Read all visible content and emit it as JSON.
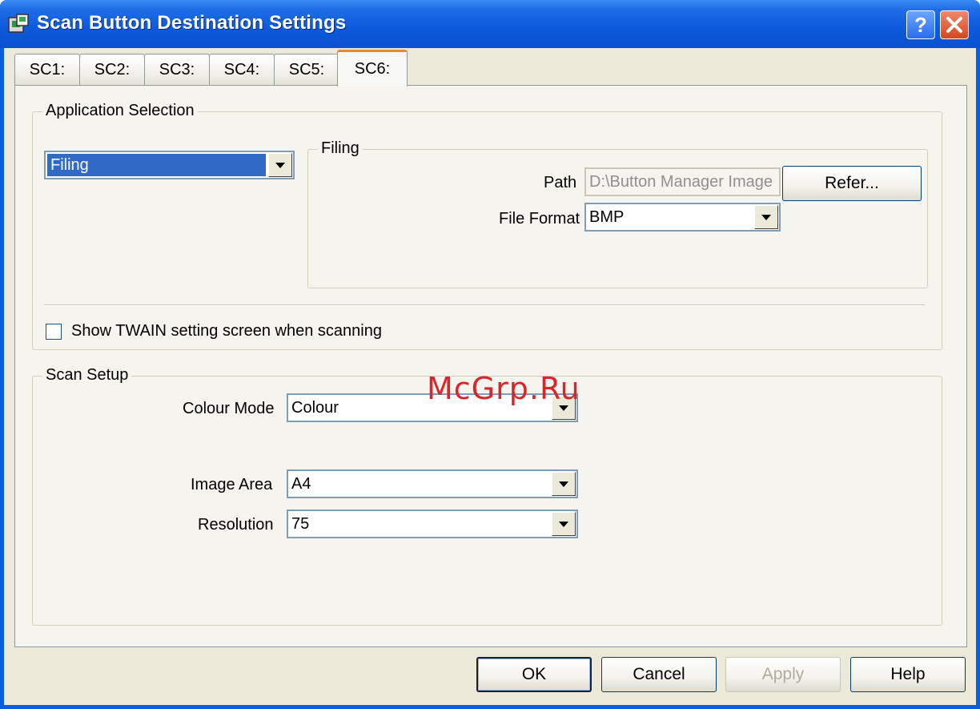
{
  "window": {
    "title": "Scan Button Destination Settings",
    "help_label": "?",
    "icon": "scanner-app-icon"
  },
  "tabs": [
    {
      "label": "SC1:"
    },
    {
      "label": "SC2:"
    },
    {
      "label": "SC3:"
    },
    {
      "label": "SC4:"
    },
    {
      "label": "SC5:"
    },
    {
      "label": "SC6:",
      "active": true
    }
  ],
  "application_selection": {
    "group_label": "Application Selection",
    "application_value": "Filing",
    "filing": {
      "group_label": "Filing",
      "path_label": "Path",
      "path_value": "D:\\Button Manager Image",
      "refer_button": "Refer...",
      "file_format_label": "File Format",
      "file_format_value": "BMP"
    },
    "show_twain_label": "Show TWAIN setting screen when scanning",
    "show_twain_checked": false
  },
  "scan_setup": {
    "group_label": "Scan Setup",
    "colour_mode_label": "Colour Mode",
    "colour_mode_value": "Colour",
    "image_area_label": "Image Area",
    "image_area_value": "A4",
    "resolution_label": "Resolution",
    "resolution_value": "75"
  },
  "watermark": "McGrp.Ru",
  "buttons": {
    "ok": "OK",
    "cancel": "Cancel",
    "apply": "Apply",
    "help": "Help"
  },
  "colors": {
    "titlebar": "#0a52d0",
    "accent_tab": "#e68b2c",
    "selection": "#316ac5",
    "watermark": "#d9262b"
  }
}
